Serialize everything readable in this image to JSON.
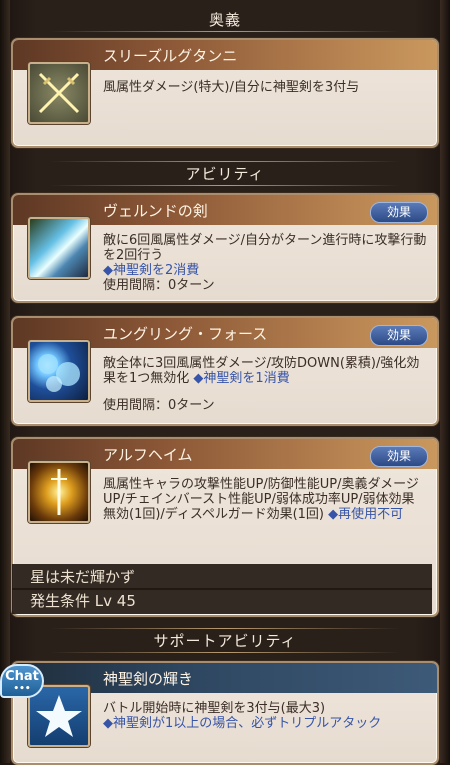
{
  "sections": {
    "ougi": "奥義",
    "ability": "アビリティ",
    "support": "サポートアビリティ"
  },
  "ougi": {
    "name": "スリーズルグタンニ",
    "desc": "風属性ダメージ(特大)/自分に神聖剣を3付与"
  },
  "abilities": [
    {
      "name": "ヴェルンドの剣",
      "effect": "効果",
      "desc": "敵に6回風属性ダメージ/自分がターン進行時に攻撃行動を2回行う",
      "note": "◆神聖剣を2消費",
      "cooldown": "使用間隔：0ターン"
    },
    {
      "name": "ユングリング・フォース",
      "effect": "効果",
      "desc": "敵全体に3回風属性ダメージ/攻防DOWN(累積)/強化効果を1つ無効化",
      "note": "◆神聖剣を1消費",
      "cooldown": "使用間隔：0ターン"
    },
    {
      "name": "アルフヘイム",
      "effect": "効果",
      "desc": "風属性キャラの攻撃性能UP/防御性能UP/奥義ダメージUP/チェインバースト性能UP/弱体成功率UP/弱体効果無効(1回)/ディスペルガード効果(1回)",
      "note": "◆再使用不可"
    }
  ],
  "locked": {
    "status": "星は未だ輝かず",
    "condition": "発生条件 Lv 45"
  },
  "support": {
    "name": "神聖剣の輝き",
    "desc": "バトル開始時に神聖剣を3付与(最大3)",
    "note": "◆神聖剣が1以上の場合、必ずトリプルアタック"
  },
  "chat": {
    "label": "Chat",
    "dots": "•••"
  },
  "colors": {
    "title_bar": "#8a5636",
    "card_bg": "#ece3d8",
    "accent_blue": "#3654a8",
    "button": "#2c4a86"
  }
}
